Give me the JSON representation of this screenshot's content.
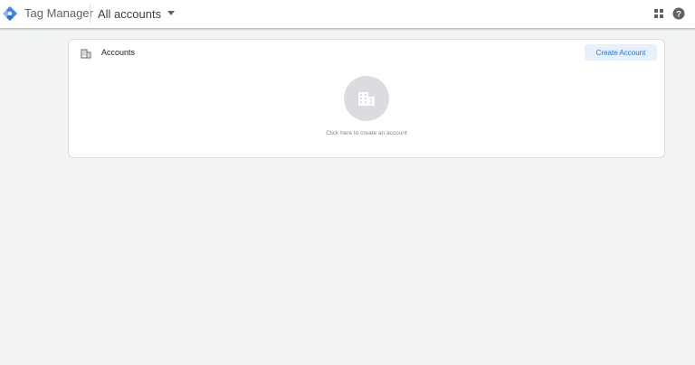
{
  "header": {
    "product_name": "Tag Manager",
    "account_selector": "All accounts",
    "icons": [
      "tag-manager-logo-icon",
      "dropdown-arrow-icon",
      "apps-grid-icon",
      "help-icon"
    ]
  },
  "accounts_card": {
    "title": "Accounts",
    "title_icon": "building-icon",
    "create_button_label": "Create Account",
    "empty_state_text": "Click here to create an account",
    "empty_state_icon": "building-icon"
  },
  "colors": {
    "background": "#f1f3f4",
    "card": "#ffffff",
    "accent": "#1a73e8",
    "button_bg": "#e8f0fe",
    "logo_blue": "#4285f4",
    "logo_dark_blue": "#1a73e8",
    "placeholder_circle": "#dadce0"
  }
}
